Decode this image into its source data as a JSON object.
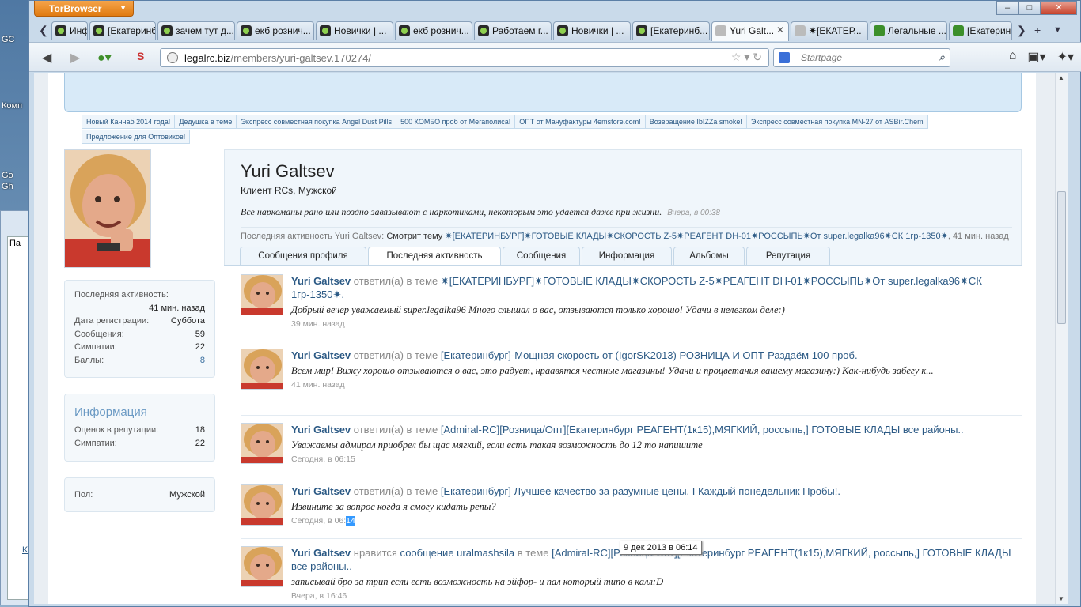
{
  "desktop": {
    "icons": [
      "GC",
      "Комп",
      "Go",
      "Gh"
    ],
    "side_window_text": "Па",
    "side_window_link": "K"
  },
  "browser": {
    "app_button": "TorBrowser",
    "window_buttons": [
      "–",
      "□",
      "✕"
    ],
    "tabs": [
      {
        "label": "Инф...",
        "icon": "alien"
      },
      {
        "label": "[Екатеринб...",
        "icon": "alien"
      },
      {
        "label": "зачем тут д...",
        "icon": "alien"
      },
      {
        "label": "екб рознич...",
        "icon": "alien"
      },
      {
        "label": "Новички | ...",
        "icon": "alien"
      },
      {
        "label": "екб рознич...",
        "icon": "alien"
      },
      {
        "label": "Работаем г...",
        "icon": "alien"
      },
      {
        "label": "Новички | ...",
        "icon": "alien"
      },
      {
        "label": "[Екатеринб...",
        "icon": "alien"
      },
      {
        "label": "Yuri Galt...",
        "icon": "blank",
        "active": true
      },
      {
        "label": "✷[ЕКАТЕР...",
        "icon": "blank"
      },
      {
        "label": "Легальные ...",
        "icon": "leaf"
      },
      {
        "label": "[Екатеринб...",
        "icon": "leaf"
      }
    ],
    "url_domain": "legalrc.biz",
    "url_path": "/members/yuri-galtsev.170274/",
    "search_placeholder": "Startpage"
  },
  "ads": [
    "Новый Каннаб 2014 года!",
    "Дедушка в теме",
    "Экспресс совместная покупка Angel Dust Pills",
    "500 КОМБО проб от Мегаполиса!",
    "ОПТ от Мануфактуры 4emstore.com!",
    "Возвращение IbIZZa smoke!",
    "Экспресс совместная покупка MN-27 от ASBir.Chem",
    "Предложение для Оптовиков!"
  ],
  "stats": [
    {
      "label": "Последняя активность:",
      "value": ""
    },
    {
      "label": "",
      "value": "41 мин. назад"
    },
    {
      "label": "Дата регистрации:",
      "value": "Суббота"
    },
    {
      "label": "Сообщения:",
      "value": "59"
    },
    {
      "label": "Симпатии:",
      "value": "22"
    },
    {
      "label": "Баллы:",
      "value": "8"
    }
  ],
  "info": {
    "title": "Информация",
    "rows": [
      {
        "label": "Оценок в репутации:",
        "value": "18"
      },
      {
        "label": "Симпатии:",
        "value": "22"
      }
    ]
  },
  "gender": {
    "label": "Пол:",
    "value": "Мужской"
  },
  "profile": {
    "name": "Yuri Galtsev",
    "title": "Клиент RCs, Мужской",
    "status": "Все наркоманы рано или поздно завязывают с наркотиками, некоторым это удается даже при жизни.",
    "status_time": "Вчера, в 00:38",
    "activity_prefix": "Последняя активность Yuri Galtsev:",
    "activity_action": "Смотрит тему",
    "activity_thread": "✷[ЕКАТЕРИНБУРГ]✷ГОТОВЫЕ КЛАДЫ✷СКОРОСТЬ Z-5✷РЕАГЕНТ DH-01✷РОССЫПЬ✷От super.legalka96✷СК 1гр-1350✷",
    "activity_time": ", 41 мин. назад"
  },
  "profile_tabs": [
    "Сообщения профиля",
    "Последняя активность",
    "Сообщения",
    "Информация",
    "Альбомы",
    "Репутация"
  ],
  "feed": [
    {
      "who": "Yuri Galtsev",
      "verb": " ответил(а) в теме ",
      "thread": "✷[ЕКАТЕРИНБУРГ]✷ГОТОВЫЕ КЛАДЫ✷СКОРОСТЬ Z-5✷РЕАГЕНТ DH-01✷РОССЫПЬ✷От super.legalka96✷СК 1гр-1350✷.",
      "quote": "Добрый вечер уважаемый super.legalka96 Много слышал о вас, отзываются только хорошо! Удачи в нелегком деле:)",
      "when": "39 мин. назад"
    },
    {
      "who": "Yuri Galtsev",
      "verb": " ответил(а) в теме ",
      "thread": "[Екатеринбург]-Мощная скорость от (IgorSK2013) РОЗНИЦА И ОПТ-Раздаём 100 проб.",
      "quote": "Всем мир! Вижу хорошо отзываются о вас, это радует, нраавятся честные магазины! Удачи и процветания вашему магазину:) Как-нибудь забегу к...",
      "when": "41 мин. назад"
    },
    {
      "who": "Yuri Galtsev",
      "verb": " ответил(а) в теме ",
      "thread": "[Admiral-RC][Розница/Опт][Екатеринбург РЕАГЕНТ(1к15),МЯГКИЙ, россыпь,] ГОТОВЫЕ КЛАДЫ все районы..",
      "quote": "Уважаемы адмирал приобрел бы щас мягкий, если есть такая возможность до 12 то напишите",
      "when": "Сегодня, в 06:15"
    },
    {
      "who": "Yuri Galtsev",
      "verb": " ответил(а) в теме ",
      "thread": "[Екатеринбург] Лучшее качество за разумные цены. I Каждый понедельник Пробы!.",
      "quote": "Извините за вопрос когда я смогу кидать репы?",
      "when_prefix": "Сегодня, в 06:",
      "when_hl": "14"
    },
    {
      "who": "Yuri Galtsev",
      "verb": " нравится ",
      "like_target": "сообщение uralmashsila",
      "verb2": " в теме ",
      "thread": "[Admiral-RC][Розница/Опт][Екатеринбург РЕАГЕНТ(1к15),МЯГКИЙ, россыпь,] ГОТОВЫЕ КЛАДЫ все районы..",
      "quote": "записывай бро за трип если есть возможность на эйфор- и пал который типо в калл:D",
      "when": "Вчера, в 16:46"
    }
  ],
  "tooltip": "9 дек 2013 в 06:14"
}
